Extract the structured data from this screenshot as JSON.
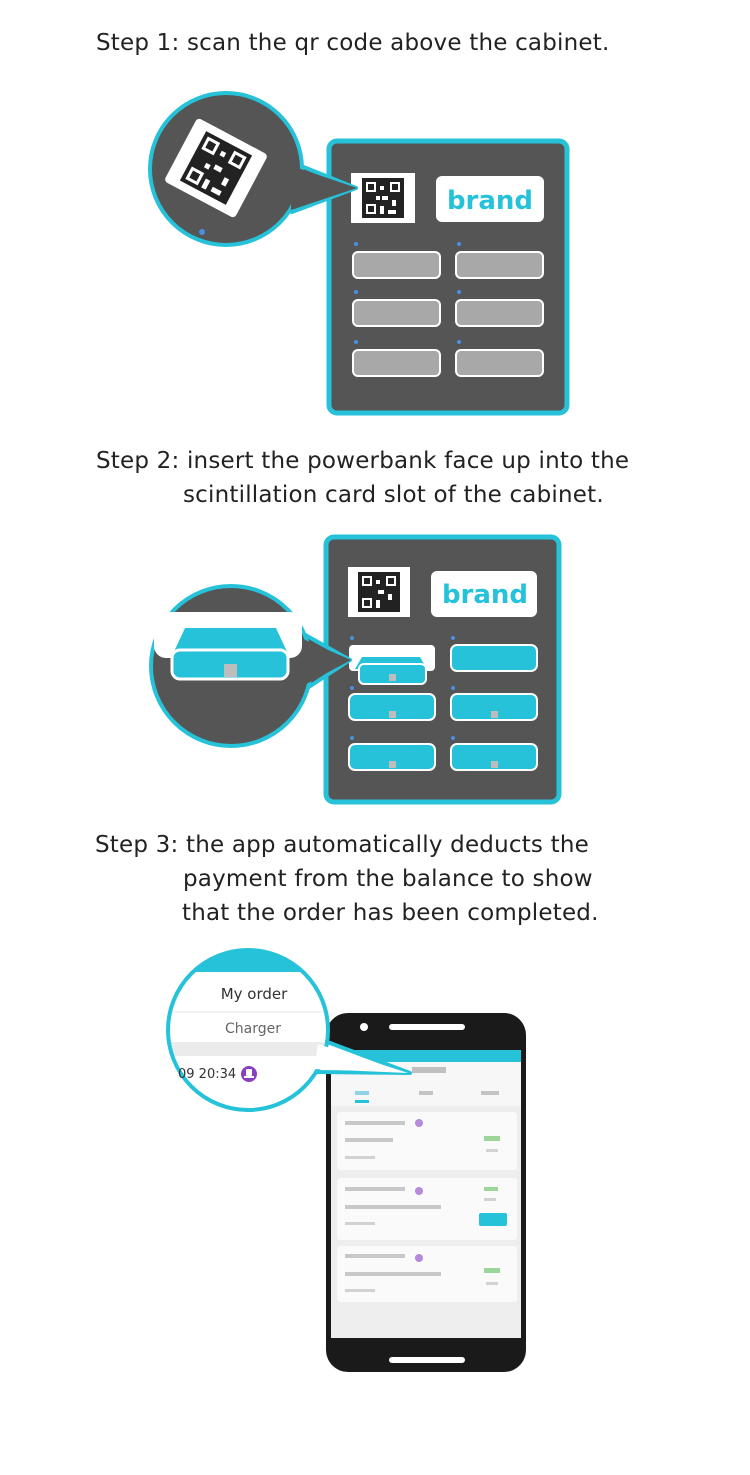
{
  "steps": [
    {
      "lines": [
        "Step 1: scan the qr code above the cabinet."
      ]
    },
    {
      "lines": [
        "Step 2: insert the powerbank face up into the",
        "scintillation card slot of the cabinet."
      ]
    },
    {
      "lines": [
        "Step 3: the app automatically deducts the",
        "payment from the balance to show",
        "that the order has been completed."
      ]
    }
  ],
  "cabinet": {
    "brand_label": "brand"
  },
  "zoom_bubble": {
    "title": "My order",
    "tab": "Charger",
    "order_time": "09 20:34"
  },
  "colors": {
    "accent": "#26c2d9",
    "cabinet_body": "#555555",
    "slot_grey": "#a8a8a8",
    "phone_body": "#1a1a1a",
    "badge": "#8a3fc0",
    "text": "#222222"
  }
}
